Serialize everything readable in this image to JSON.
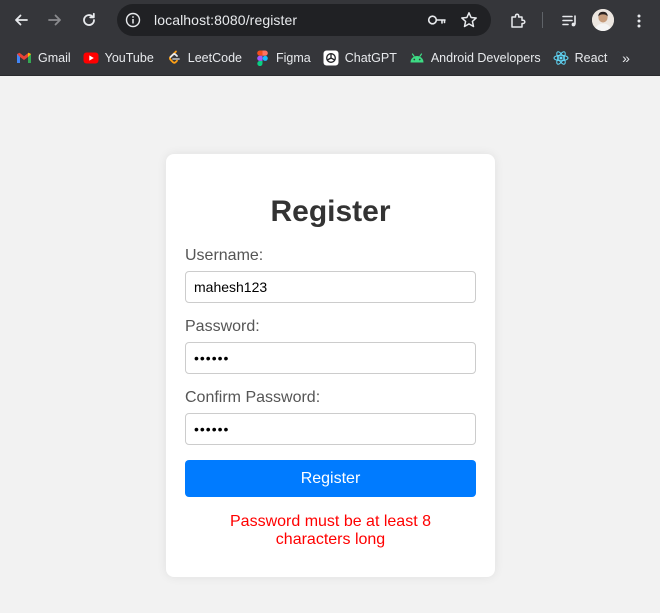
{
  "browser": {
    "url_host": "localhost",
    "url_rest": ":8080/register",
    "bookmarks": [
      {
        "label": "Gmail",
        "icon": "gmail-icon"
      },
      {
        "label": "YouTube",
        "icon": "youtube-icon"
      },
      {
        "label": "LeetCode",
        "icon": "leetcode-icon"
      },
      {
        "label": "Figma",
        "icon": "figma-icon"
      },
      {
        "label": "ChatGPT",
        "icon": "chatgpt-icon"
      },
      {
        "label": "Android Developers",
        "icon": "android-icon"
      },
      {
        "label": "React",
        "icon": "react-icon"
      }
    ],
    "overflow_label": "»"
  },
  "form": {
    "title": "Register",
    "username_label": "Username:",
    "username_value": "mahesh123",
    "password_label": "Password:",
    "password_value": "123456",
    "confirm_label": "Confirm Password:",
    "confirm_value": "123456",
    "submit_label": "Register",
    "error": "Password must be at least 8 characters long"
  },
  "colors": {
    "chrome_bg": "#35363a",
    "omnibox_bg": "#202124",
    "page_bg": "#f2f2f2",
    "button": "#007bff",
    "error": "#ff0000"
  }
}
